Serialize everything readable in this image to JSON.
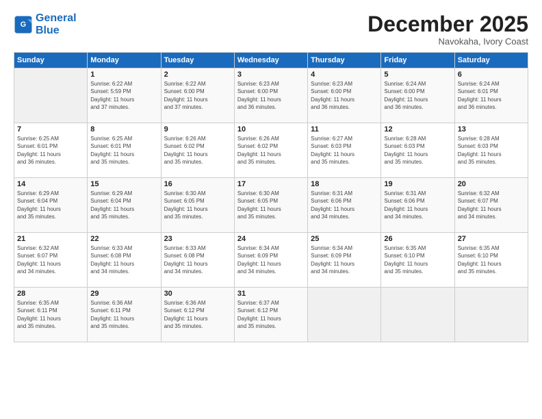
{
  "header": {
    "logo_line1": "General",
    "logo_line2": "Blue",
    "month": "December 2025",
    "location": "Navokaha, Ivory Coast"
  },
  "weekdays": [
    "Sunday",
    "Monday",
    "Tuesday",
    "Wednesday",
    "Thursday",
    "Friday",
    "Saturday"
  ],
  "weeks": [
    [
      {
        "day": "",
        "content": ""
      },
      {
        "day": "1",
        "content": "Sunrise: 6:22 AM\nSunset: 5:59 PM\nDaylight: 11 hours\nand 37 minutes."
      },
      {
        "day": "2",
        "content": "Sunrise: 6:22 AM\nSunset: 6:00 PM\nDaylight: 11 hours\nand 37 minutes."
      },
      {
        "day": "3",
        "content": "Sunrise: 6:23 AM\nSunset: 6:00 PM\nDaylight: 11 hours\nand 36 minutes."
      },
      {
        "day": "4",
        "content": "Sunrise: 6:23 AM\nSunset: 6:00 PM\nDaylight: 11 hours\nand 36 minutes."
      },
      {
        "day": "5",
        "content": "Sunrise: 6:24 AM\nSunset: 6:00 PM\nDaylight: 11 hours\nand 36 minutes."
      },
      {
        "day": "6",
        "content": "Sunrise: 6:24 AM\nSunset: 6:01 PM\nDaylight: 11 hours\nand 36 minutes."
      }
    ],
    [
      {
        "day": "7",
        "content": "Sunrise: 6:25 AM\nSunset: 6:01 PM\nDaylight: 11 hours\nand 36 minutes."
      },
      {
        "day": "8",
        "content": "Sunrise: 6:25 AM\nSunset: 6:01 PM\nDaylight: 11 hours\nand 35 minutes."
      },
      {
        "day": "9",
        "content": "Sunrise: 6:26 AM\nSunset: 6:02 PM\nDaylight: 11 hours\nand 35 minutes."
      },
      {
        "day": "10",
        "content": "Sunrise: 6:26 AM\nSunset: 6:02 PM\nDaylight: 11 hours\nand 35 minutes."
      },
      {
        "day": "11",
        "content": "Sunrise: 6:27 AM\nSunset: 6:03 PM\nDaylight: 11 hours\nand 35 minutes."
      },
      {
        "day": "12",
        "content": "Sunrise: 6:28 AM\nSunset: 6:03 PM\nDaylight: 11 hours\nand 35 minutes."
      },
      {
        "day": "13",
        "content": "Sunrise: 6:28 AM\nSunset: 6:03 PM\nDaylight: 11 hours\nand 35 minutes."
      }
    ],
    [
      {
        "day": "14",
        "content": "Sunrise: 6:29 AM\nSunset: 6:04 PM\nDaylight: 11 hours\nand 35 minutes."
      },
      {
        "day": "15",
        "content": "Sunrise: 6:29 AM\nSunset: 6:04 PM\nDaylight: 11 hours\nand 35 minutes."
      },
      {
        "day": "16",
        "content": "Sunrise: 6:30 AM\nSunset: 6:05 PM\nDaylight: 11 hours\nand 35 minutes."
      },
      {
        "day": "17",
        "content": "Sunrise: 6:30 AM\nSunset: 6:05 PM\nDaylight: 11 hours\nand 35 minutes."
      },
      {
        "day": "18",
        "content": "Sunrise: 6:31 AM\nSunset: 6:06 PM\nDaylight: 11 hours\nand 34 minutes."
      },
      {
        "day": "19",
        "content": "Sunrise: 6:31 AM\nSunset: 6:06 PM\nDaylight: 11 hours\nand 34 minutes."
      },
      {
        "day": "20",
        "content": "Sunrise: 6:32 AM\nSunset: 6:07 PM\nDaylight: 11 hours\nand 34 minutes."
      }
    ],
    [
      {
        "day": "21",
        "content": "Sunrise: 6:32 AM\nSunset: 6:07 PM\nDaylight: 11 hours\nand 34 minutes."
      },
      {
        "day": "22",
        "content": "Sunrise: 6:33 AM\nSunset: 6:08 PM\nDaylight: 11 hours\nand 34 minutes."
      },
      {
        "day": "23",
        "content": "Sunrise: 6:33 AM\nSunset: 6:08 PM\nDaylight: 11 hours\nand 34 minutes."
      },
      {
        "day": "24",
        "content": "Sunrise: 6:34 AM\nSunset: 6:09 PM\nDaylight: 11 hours\nand 34 minutes."
      },
      {
        "day": "25",
        "content": "Sunrise: 6:34 AM\nSunset: 6:09 PM\nDaylight: 11 hours\nand 34 minutes."
      },
      {
        "day": "26",
        "content": "Sunrise: 6:35 AM\nSunset: 6:10 PM\nDaylight: 11 hours\nand 35 minutes."
      },
      {
        "day": "27",
        "content": "Sunrise: 6:35 AM\nSunset: 6:10 PM\nDaylight: 11 hours\nand 35 minutes."
      }
    ],
    [
      {
        "day": "28",
        "content": "Sunrise: 6:35 AM\nSunset: 6:11 PM\nDaylight: 11 hours\nand 35 minutes."
      },
      {
        "day": "29",
        "content": "Sunrise: 6:36 AM\nSunset: 6:11 PM\nDaylight: 11 hours\nand 35 minutes."
      },
      {
        "day": "30",
        "content": "Sunrise: 6:36 AM\nSunset: 6:12 PM\nDaylight: 11 hours\nand 35 minutes."
      },
      {
        "day": "31",
        "content": "Sunrise: 6:37 AM\nSunset: 6:12 PM\nDaylight: 11 hours\nand 35 minutes."
      },
      {
        "day": "",
        "content": ""
      },
      {
        "day": "",
        "content": ""
      },
      {
        "day": "",
        "content": ""
      }
    ]
  ]
}
